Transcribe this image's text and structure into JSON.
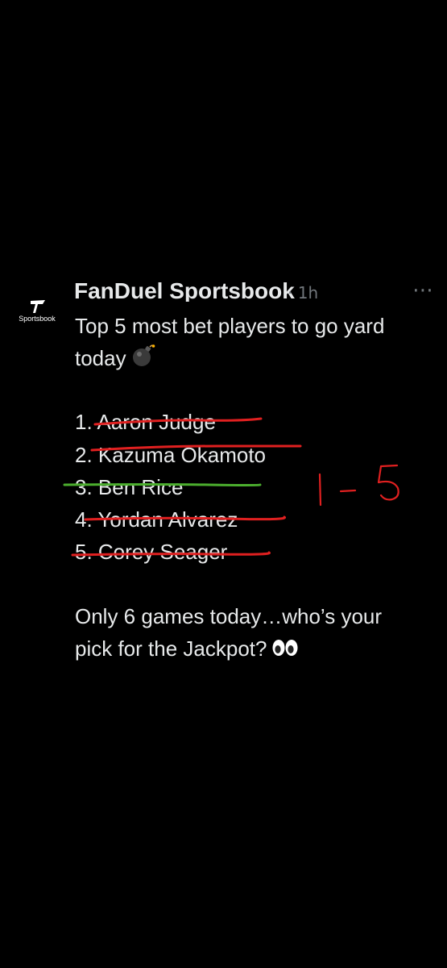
{
  "header": {
    "account_name": "FanDuel Sportsbook",
    "avatar_label": "Sportsbook",
    "meta": "· 1h"
  },
  "post": {
    "intro_line1": "Top 5 most bet players to go yard",
    "intro_line2": "today",
    "list": [
      "1. Aaron Judge",
      "2. Kazuma Okamoto",
      "3. Ben Rice",
      "4. Yordan Alvarez",
      "5. Corey Seager"
    ],
    "outro_line1": "Only 6 games today…who’s your",
    "outro_line2": "pick for the Jackpot?"
  },
  "annotation": {
    "handwritten_note": "1 - 5",
    "strike_colors": [
      "#e02020",
      "#e02020",
      "#4caf2e",
      "#e02020",
      "#e02020"
    ],
    "note_color": "#e02020"
  },
  "icons": {
    "bomb": "bomb-emoji",
    "eyes": "eyes-emoji",
    "more": "more-icon"
  }
}
